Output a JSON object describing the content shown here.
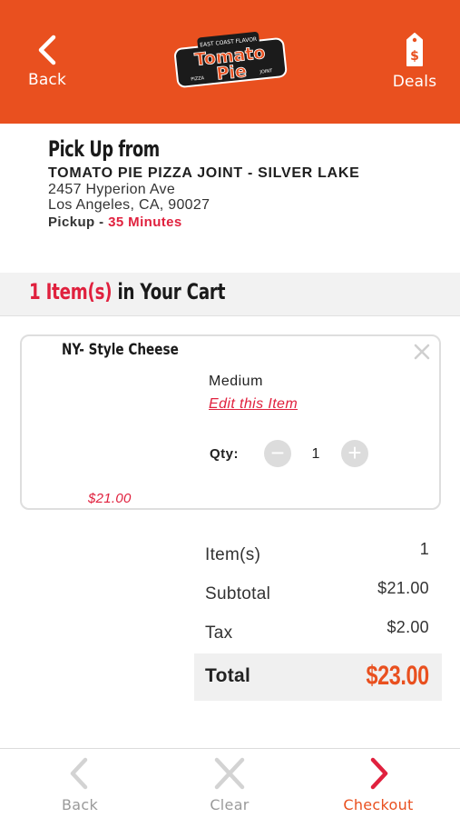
{
  "header": {
    "back_label": "Back",
    "deals_label": "Deals",
    "logo": {
      "top_text": "EAST COAST FLAVOR",
      "brand_line1": "Tomato",
      "brand_line2": "Pie",
      "left_text": "PIZZA",
      "right_text": "JOINT"
    },
    "background_color": "#e9501f"
  },
  "pickup": {
    "heading": "Pick Up from",
    "store_name": "TOMATO PIE PIZZA JOINT - SILVER LAKE",
    "address_line1": "2457 Hyperion Ave",
    "address_line2": "Los Angeles, CA, 90027",
    "pickup_label": "Pickup - ",
    "pickup_time": "35 Minutes"
  },
  "cart": {
    "count_text": "1 Item(s)",
    "title_suffix": " in Your Cart"
  },
  "item": {
    "name": "NY- Style Cheese",
    "size": "Medium",
    "edit_label": "Edit this Item",
    "qty_label": "Qty:",
    "qty_minus": "−",
    "qty_value": "1",
    "qty_plus": "+",
    "price": "$21.00"
  },
  "totals": {
    "items_label": "Item(s)",
    "items_value": "1",
    "subtotal_label": "Subtotal",
    "subtotal_value": "$21.00",
    "tax_label": "Tax",
    "tax_value": "$2.00",
    "total_label": "Total",
    "total_value": "$23.00"
  },
  "footer": {
    "back_label": "Back",
    "clear_label": "Clear",
    "checkout_label": "Checkout"
  },
  "colors": {
    "brand_orange": "#e9501f",
    "accent_red": "#e0213e",
    "muted_gray": "#9a9a9a"
  }
}
